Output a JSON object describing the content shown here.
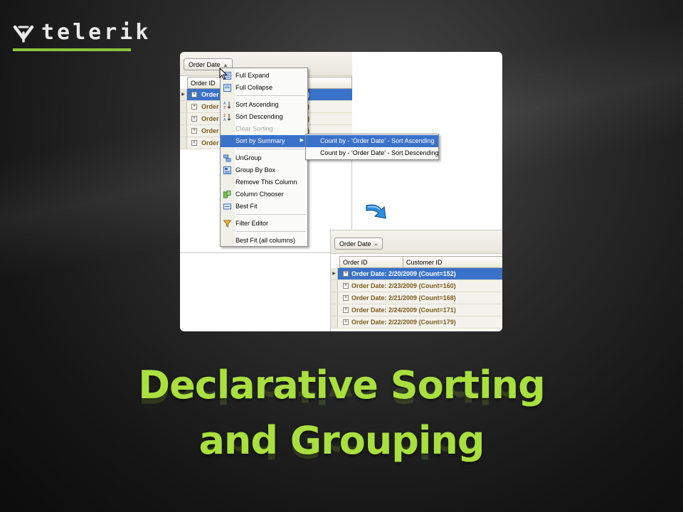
{
  "brand": {
    "logo_text": "telerik",
    "accent": "#8cc43c"
  },
  "slide": {
    "title_line1": "Declarative Sorting",
    "title_line2": "and Grouping",
    "title_color": "#a9df3e"
  },
  "grid_before": {
    "group_chip": "Order Date",
    "column_header": "Order ID",
    "rows": [
      {
        "text": "Order",
        "suffix": "2)"
      },
      {
        "text": "Order",
        "suffix": "9)"
      },
      {
        "text": "Order",
        "suffix": "3)"
      },
      {
        "text": "Order",
        "suffix": "0)"
      },
      {
        "text": "Order",
        "suffix": "9)"
      }
    ]
  },
  "context_menu": {
    "items": [
      {
        "label": "Full Expand"
      },
      {
        "label": "Full Collapse"
      },
      {
        "label": "Sort Ascending"
      },
      {
        "label": "Sort Descending"
      },
      {
        "label": "Clear Sorting"
      },
      {
        "label": "Sort by Summary"
      },
      {
        "label": "UnGroup"
      },
      {
        "label": "Group By Box"
      },
      {
        "label": "Remove This Column"
      },
      {
        "label": "Column Chooser"
      },
      {
        "label": "Best Fit"
      },
      {
        "label": "Filter Editor"
      },
      {
        "label": "Best Fit (all columns)"
      }
    ],
    "submenu": [
      {
        "label": "Count by - 'Order Date' - Sort Ascending"
      },
      {
        "label": "Count by - 'Order Date' - Sort Descending"
      }
    ]
  },
  "grid_after": {
    "group_chip": "Order Date",
    "columns": [
      "Order ID",
      "Customer ID"
    ],
    "rows": [
      {
        "text": "Order Date: 2/20/2009 (Count=152)"
      },
      {
        "text": "Order Date: 2/23/2009 (Count=160)"
      },
      {
        "text": "Order Date: 2/21/2009 (Count=168)"
      },
      {
        "text": "Order Date: 2/24/2009 (Count=171)"
      },
      {
        "text": "Order Date: 2/22/2009 (Count=179)"
      }
    ]
  },
  "colors": {
    "selection": "#3a72c9",
    "group_text": "#7b5a1c"
  }
}
